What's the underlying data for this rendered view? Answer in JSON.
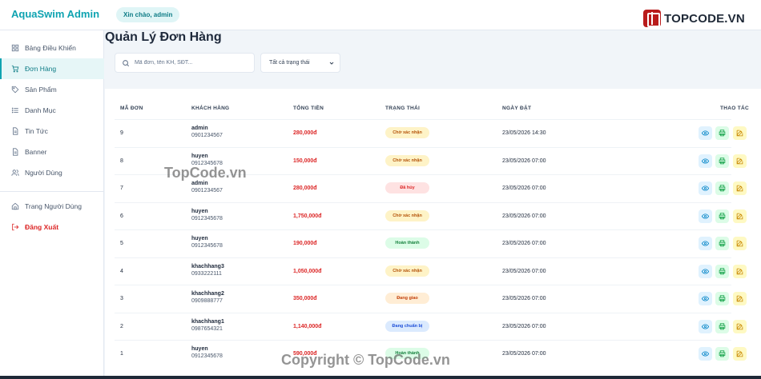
{
  "header": {
    "brand": "AquaSwim Admin",
    "greeting": "Xin chào, admin",
    "logo_text": "TOPCODE.VN"
  },
  "sidebar": {
    "items": [
      {
        "label": "Bảng Điều Khiển",
        "icon": "grid-icon"
      },
      {
        "label": "Đơn Hàng",
        "icon": "cart-icon",
        "active": true
      },
      {
        "label": "Sản Phẩm",
        "icon": "tag-icon"
      },
      {
        "label": "Danh Mục",
        "icon": "list-icon"
      },
      {
        "label": "Tin Tức",
        "icon": "document-icon"
      },
      {
        "label": "Banner",
        "icon": "document-icon"
      },
      {
        "label": "Người Dùng",
        "icon": "users-icon"
      }
    ],
    "bottom_items": [
      {
        "label": "Trang Người Dùng",
        "icon": "home-icon"
      },
      {
        "label": "Đăng Xuất",
        "icon": "logout-icon"
      }
    ]
  },
  "main": {
    "title": "Quản Lý Đơn Hàng",
    "search_placeholder": "Mã đơn, tên KH, SĐT...",
    "status_filter": "Tất cả trạng thái"
  },
  "table": {
    "columns": [
      "MÃ ĐƠN",
      "KHÁCH HÀNG",
      "TỔNG TIỀN",
      "TRẠNG THÁI",
      "NGÀY ĐẶT",
      "THAO TÁC"
    ],
    "rows": [
      {
        "id": "9",
        "name": "admin",
        "phone": "0901234567",
        "total": "280,000đ",
        "status": "Chờ xác nhận",
        "date": "23/05/2026 14:30"
      },
      {
        "id": "8",
        "name": "huyen",
        "phone": "0912345678",
        "total": "150,000đ",
        "status": "Chờ xác nhận",
        "date": "23/05/2026 07:00"
      },
      {
        "id": "7",
        "name": "admin",
        "phone": "0901234567",
        "total": "280,000đ",
        "status": "Đã hủy",
        "date": "23/05/2026 07:00"
      },
      {
        "id": "6",
        "name": "huyen",
        "phone": "0912345678",
        "total": "1,750,000đ",
        "status": "Chờ xác nhận",
        "date": "23/05/2026 07:00"
      },
      {
        "id": "5",
        "name": "huyen",
        "phone": "0912345678",
        "total": "190,000đ",
        "status": "Hoàn thành",
        "date": "23/05/2026 07:00"
      },
      {
        "id": "4",
        "name": "khachhang3",
        "phone": "0933222111",
        "total": "1,050,000đ",
        "status": "Chờ xác nhận",
        "date": "23/05/2026 07:00"
      },
      {
        "id": "3",
        "name": "khachhang2",
        "phone": "0909888777",
        "total": "350,000đ",
        "status": "Đang giao",
        "date": "23/05/2026 07:00"
      },
      {
        "id": "2",
        "name": "khachhang1",
        "phone": "0987654321",
        "total": "1,140,000đ",
        "status": "Đang chuẩn bị",
        "date": "23/05/2026 07:00"
      },
      {
        "id": "1",
        "name": "huyen",
        "phone": "0912345678",
        "total": "590,000đ",
        "status": "Hoàn thành",
        "date": "23/05/2026 07:00"
      }
    ]
  },
  "status_colors": {
    "Chờ xác nhận": {
      "bg": "#fef3c7",
      "fg": "#b45309"
    },
    "Đã hủy": {
      "bg": "#fee2e2",
      "fg": "#dc2626"
    },
    "Hoàn thành": {
      "bg": "#dcfce7",
      "fg": "#15803d"
    },
    "Đang giao": {
      "bg": "#ffedd5",
      "fg": "#c2410c"
    },
    "Đang chuẩn bị": {
      "bg": "#dbeafe",
      "fg": "#1d4ed8"
    }
  },
  "watermarks": {
    "mid": "TopCode.vn",
    "bottom": "Copyright © TopCode.vn"
  }
}
